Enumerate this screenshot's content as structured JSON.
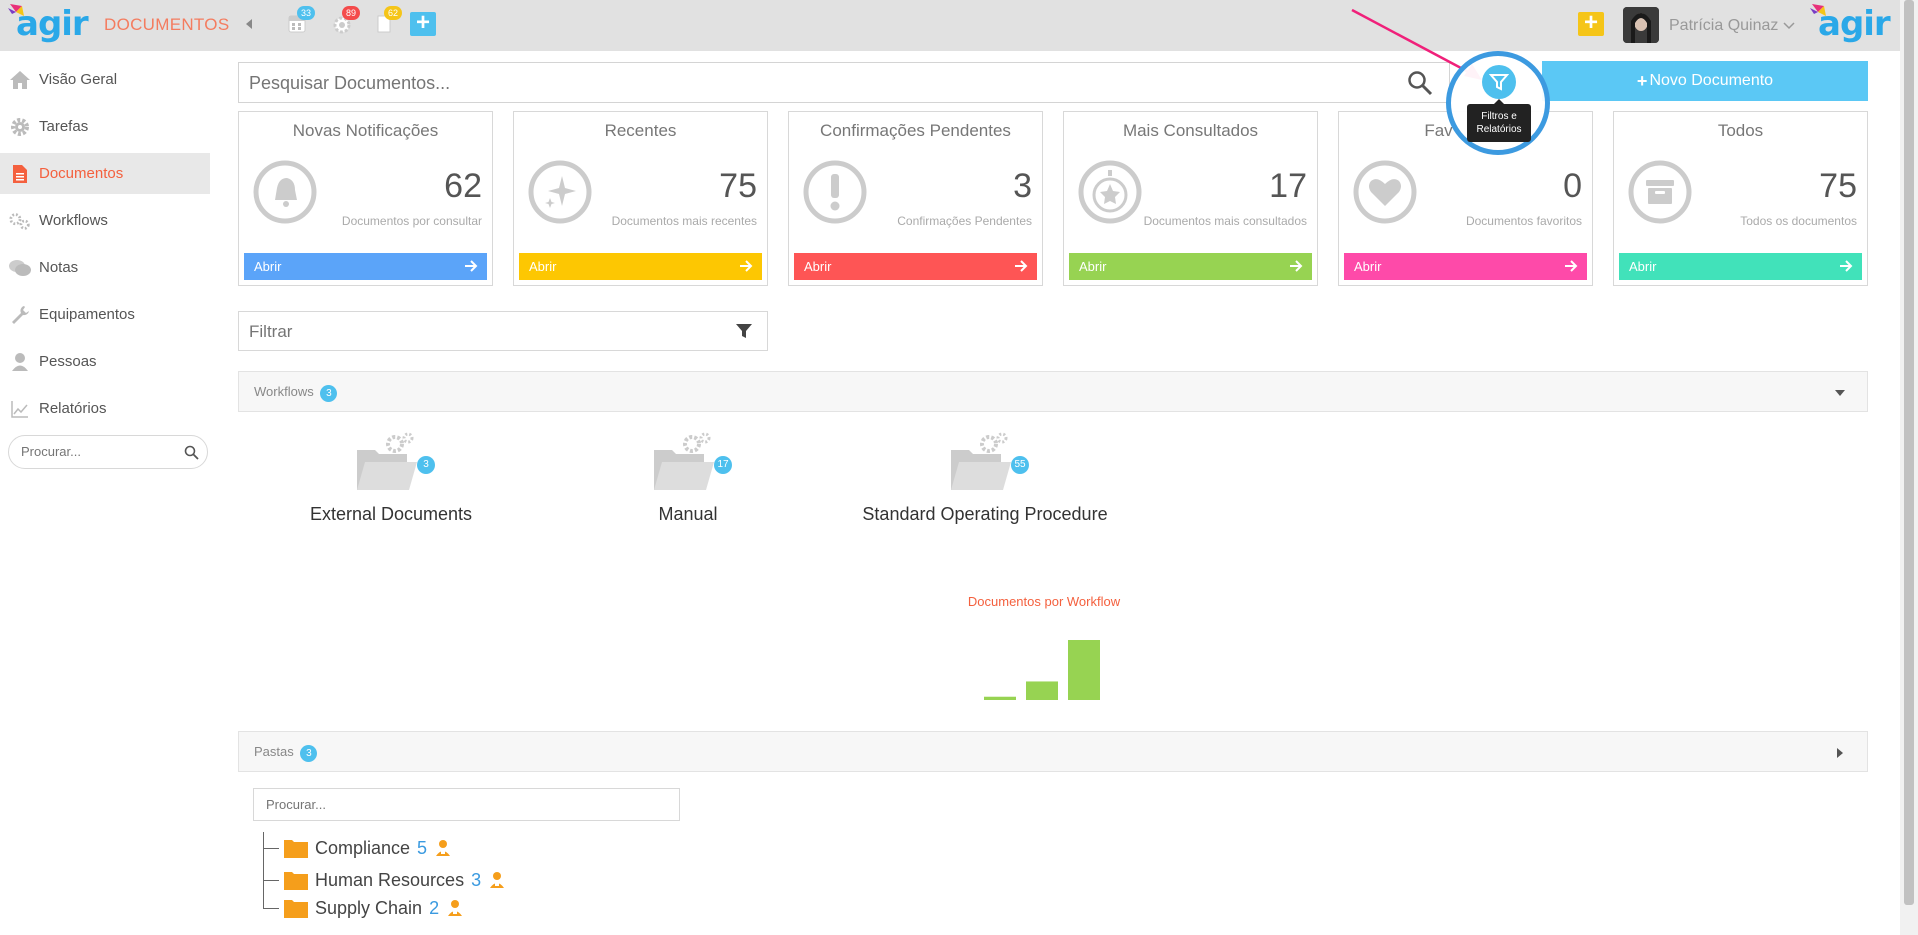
{
  "header": {
    "logo_text": "agir",
    "app_title": "DOCUMENTOS",
    "badges": [
      {
        "icon": "calendar-icon",
        "count": "33",
        "color": "#4ec0ee"
      },
      {
        "icon": "gear-icon",
        "count": "89",
        "color": "#f44b4b"
      },
      {
        "icon": "document-icon",
        "count": "62",
        "color": "#f5c518"
      }
    ],
    "add_button_label": "+",
    "quick_add_label": "+",
    "user_name": "Patrícia Quinaz"
  },
  "sidebar": {
    "items": [
      {
        "label": "Visão Geral",
        "icon": "home-icon"
      },
      {
        "label": "Tarefas",
        "icon": "gear-icon"
      },
      {
        "label": "Documentos",
        "icon": "document-icon",
        "active": true
      },
      {
        "label": "Workflows",
        "icon": "gears-icon"
      },
      {
        "label": "Notas",
        "icon": "chat-icon"
      },
      {
        "label": "Equipamentos",
        "icon": "wrench-icon"
      },
      {
        "label": "Pessoas",
        "icon": "person-icon"
      },
      {
        "label": "Relatórios",
        "icon": "chart-icon"
      }
    ],
    "search_placeholder": "Procurar..."
  },
  "search": {
    "placeholder": "Pesquisar Documentos...",
    "new_doc_label": "Novo Documento",
    "filter_tooltip_line1": "Filtros e",
    "filter_tooltip_line2": "Relatórios"
  },
  "cards": [
    {
      "title": "Novas Notificações",
      "count": "62",
      "subtitle": "Documentos por consultar",
      "button": "Abrir",
      "color": "#5ba4f9",
      "icon": "bell-icon"
    },
    {
      "title": "Recentes",
      "count": "75",
      "subtitle": "Documentos mais recentes",
      "button": "Abrir",
      "color": "#fdc702",
      "icon": "sparkle-icon"
    },
    {
      "title": "Confirmações Pendentes",
      "count": "3",
      "subtitle": "Confirmações Pendentes",
      "button": "Abrir",
      "color": "#fe5555",
      "icon": "exclamation-icon"
    },
    {
      "title": "Mais Consultados",
      "count": "17",
      "subtitle": "Documentos mais consultados",
      "button": "Abrir",
      "color": "#97d352",
      "icon": "star-icon"
    },
    {
      "title": "Fav",
      "count": "0",
      "subtitle": "Documentos favoritos",
      "button": "Abrir",
      "color": "#fe4aa9",
      "icon": "heart-icon"
    },
    {
      "title": "Todos",
      "count": "75",
      "subtitle": "Todos os documentos",
      "button": "Abrir",
      "color": "#41e2ba",
      "icon": "archive-icon"
    }
  ],
  "filter": {
    "placeholder": "Filtrar"
  },
  "workflows_section": {
    "title": "Workflows",
    "count": "3",
    "items": [
      {
        "label": "External Documents",
        "count": "3"
      },
      {
        "label": "Manual",
        "count": "17"
      },
      {
        "label": "Standard Operating Procedure",
        "count": "55"
      }
    ]
  },
  "chart_data": {
    "type": "bar",
    "title": "Documentos por Workflow",
    "categories": [
      "External Documents",
      "Manual",
      "Standard Operating Procedure"
    ],
    "values": [
      3,
      17,
      55
    ],
    "color": "#97d352",
    "xlabel": "",
    "ylabel": "",
    "ylim": [
      0,
      55
    ],
    "grid": false,
    "legend": "none"
  },
  "pastas_section": {
    "title": "Pastas",
    "count": "3",
    "search_placeholder": "Procurar...",
    "folders": [
      {
        "name": "Compliance",
        "count": "5"
      },
      {
        "name": "Human Resources",
        "count": "3"
      },
      {
        "name": "Supply Chain",
        "count": "2"
      }
    ]
  }
}
